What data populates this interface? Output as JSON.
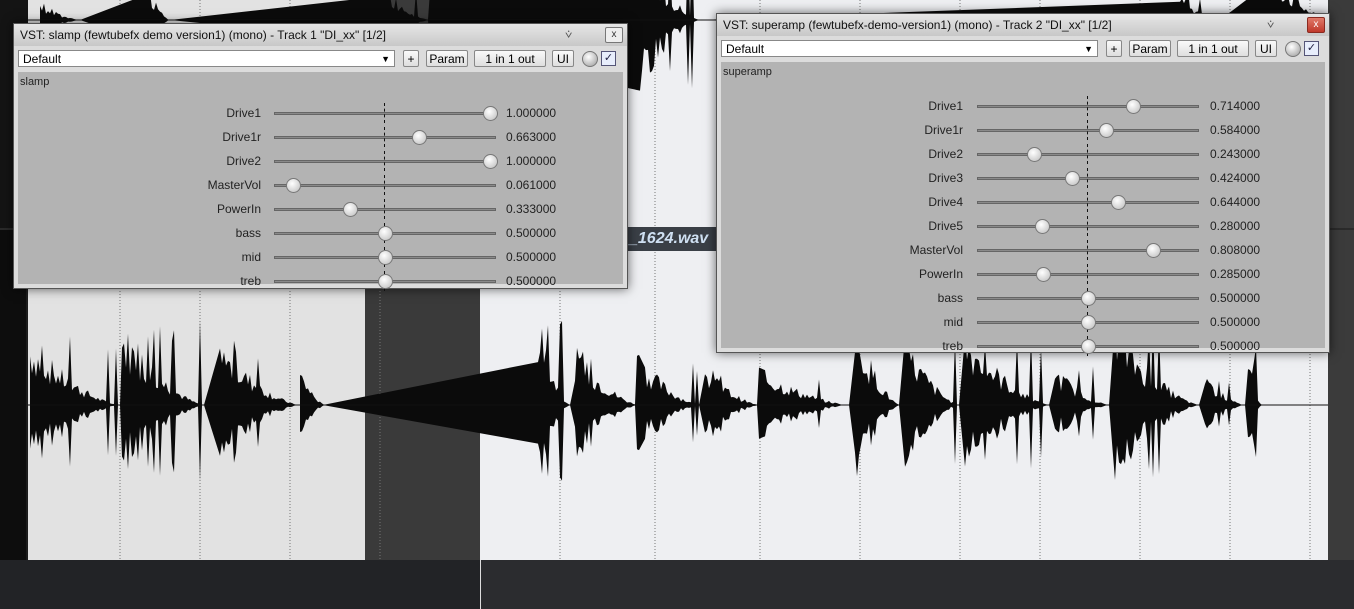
{
  "clip_label": "_1624.wav",
  "windows": [
    {
      "title": "VST: slamp (fewtubefx demo version1) (mono) - Track 1 \"DI_xx\" [1/2]",
      "preset": "Default",
      "add_label": "+",
      "param_label": "Param",
      "io_label": "1 in 1 out",
      "ui_label": "UI",
      "close_label": "x",
      "bypass_checked": true,
      "plugin_name": "slamp",
      "params": [
        {
          "name": "Drive1",
          "value": 1.0,
          "display": "1.000000"
        },
        {
          "name": "Drive1r",
          "value": 0.663,
          "display": "0.663000"
        },
        {
          "name": "Drive2",
          "value": 1.0,
          "display": "1.000000"
        },
        {
          "name": "MasterVol",
          "value": 0.061,
          "display": "0.061000"
        },
        {
          "name": "PowerIn",
          "value": 0.333,
          "display": "0.333000"
        },
        {
          "name": "bass",
          "value": 0.5,
          "display": "0.500000"
        },
        {
          "name": "mid",
          "value": 0.5,
          "display": "0.500000"
        },
        {
          "name": "treb",
          "value": 0.5,
          "display": "0.500000"
        }
      ]
    },
    {
      "title": "VST: superamp (fewtubefx-demo-version1) (mono) - Track 2 \"DI_xx\" [1/2]",
      "preset": "Default",
      "add_label": "+",
      "param_label": "Param",
      "io_label": "1 in 1 out",
      "ui_label": "UI",
      "close_label": "x",
      "bypass_checked": true,
      "plugin_name": "superamp",
      "params": [
        {
          "name": "Drive1",
          "value": 0.714,
          "display": "0.714000"
        },
        {
          "name": "Drive1r",
          "value": 0.584,
          "display": "0.584000"
        },
        {
          "name": "Drive2",
          "value": 0.243,
          "display": "0.243000"
        },
        {
          "name": "Drive3",
          "value": 0.424,
          "display": "0.424000"
        },
        {
          "name": "Drive4",
          "value": 0.644,
          "display": "0.644000"
        },
        {
          "name": "Drive5",
          "value": 0.28,
          "display": "0.280000"
        },
        {
          "name": "MasterVol",
          "value": 0.808,
          "display": "0.808000"
        },
        {
          "name": "PowerIn",
          "value": 0.285,
          "display": "0.285000"
        },
        {
          "name": "bass",
          "value": 0.5,
          "display": "0.500000"
        },
        {
          "name": "mid",
          "value": 0.5,
          "display": "0.500000"
        },
        {
          "name": "treb",
          "value": 0.5,
          "display": "0.500000"
        }
      ]
    }
  ]
}
